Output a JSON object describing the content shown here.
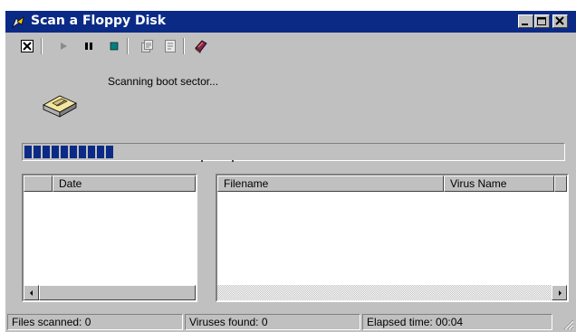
{
  "window": {
    "title": "Scan a Floppy Disk"
  },
  "titlebar_buttons": [
    "minimize",
    "maximize",
    "close"
  ],
  "toolbar": {
    "tools": [
      "stop-scan-icon",
      "play-icon",
      "pause-icon",
      "stop-icon",
      "properties-icon",
      "report-icon",
      "virus-encyclopedia-icon"
    ]
  },
  "scan": {
    "status": "Scanning boot sector...",
    "progress_blocks": 10
  },
  "list": {
    "columns": [
      "Date",
      "Filename",
      "Virus Name"
    ],
    "rows": []
  },
  "statusbar": {
    "files_scanned": "Files scanned: 0",
    "viruses_found": "Viruses found: 0",
    "elapsed": "Elapsed time: 00:04"
  },
  "colors": {
    "titlebar": "#0a2a86",
    "face": "#c0c0c0",
    "progress": "#0a2a86"
  }
}
